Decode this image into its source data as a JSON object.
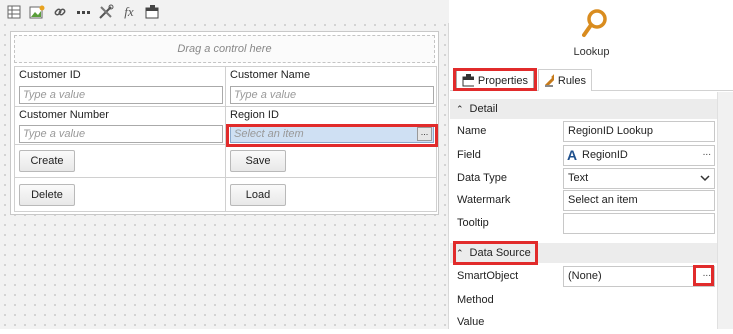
{
  "toolbar": {
    "icons": [
      "table-icon",
      "image-icon",
      "link-icon",
      "more-icon",
      "tools-icon",
      "function-icon",
      "form-icon"
    ],
    "fx_label": "fx"
  },
  "canvas": {
    "drop_hint": "Drag a control here",
    "customer_id": {
      "label": "Customer ID",
      "placeholder": "Type a value"
    },
    "customer_name": {
      "label": "Customer Name",
      "placeholder": "Type a value"
    },
    "customer_number": {
      "label": "Customer Number",
      "placeholder": "Type a value"
    },
    "region_id": {
      "label": "Region ID",
      "placeholder": "Select an item",
      "button": "..."
    },
    "buttons": {
      "create": "Create",
      "save": "Save",
      "delete": "Delete",
      "load": "Load"
    }
  },
  "panel": {
    "control_name": "Lookup",
    "tabs": {
      "properties": "Properties",
      "rules": "Rules"
    },
    "detail": {
      "header": "Detail",
      "name_label": "Name",
      "name_value": "RegionID Lookup",
      "field_label": "Field",
      "field_value": "RegionID",
      "field_icon_letter": "A",
      "field_button": "...",
      "datatype_label": "Data Type",
      "datatype_value": "Text",
      "watermark_label": "Watermark",
      "watermark_value": "Select an item",
      "tooltip_label": "Tooltip",
      "tooltip_value": ""
    },
    "datasource": {
      "header": "Data Source",
      "smartobject_label": "SmartObject",
      "smartobject_value": "(None)",
      "smartobject_button": "...",
      "method_label": "Method",
      "value_label": "Value"
    }
  },
  "colors": {
    "highlight": "#e12b2b",
    "lookup_icon": "#d98c1f",
    "field_icon": "#1e4f8c",
    "select_bg": "#cfe0f3"
  }
}
